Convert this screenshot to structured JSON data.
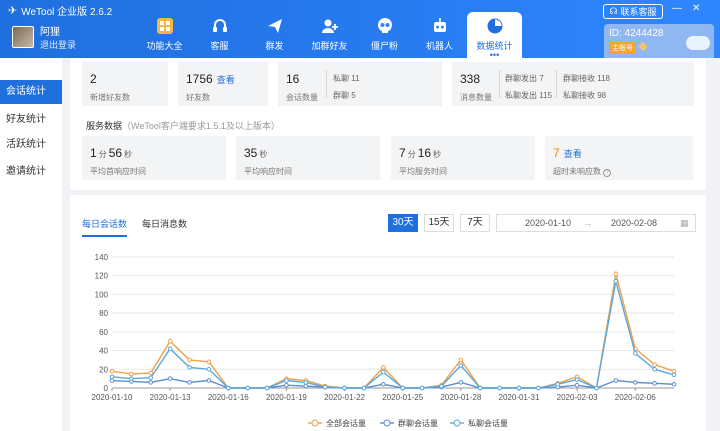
{
  "app": {
    "title": "WeTool 企业版 2.6.2",
    "service_label": "联系客服",
    "id_text": "ID: 4244428",
    "account_badge": "主账号"
  },
  "user": {
    "name": "阿狸",
    "logout": "退出登录"
  },
  "nav": [
    {
      "label": "功能大全",
      "icon": "grid-icon"
    },
    {
      "label": "客服",
      "icon": "headset-icon"
    },
    {
      "label": "群发",
      "icon": "paper-plane-icon"
    },
    {
      "label": "加群好友",
      "icon": "add-friend-icon"
    },
    {
      "label": "僵尸粉",
      "icon": "skull-icon"
    },
    {
      "label": "机器人",
      "icon": "robot-icon"
    },
    {
      "label": "数据统计",
      "icon": "pie-chart-icon"
    }
  ],
  "sidebar": [
    {
      "label": "会话统计"
    },
    {
      "label": "好友统计"
    },
    {
      "label": "活跃统计"
    },
    {
      "label": "邀请统计"
    }
  ],
  "stats": {
    "new_friends": {
      "value": "2",
      "label": "新增好友数"
    },
    "friends": {
      "value": "1756",
      "link": "查看",
      "label": "好友数"
    },
    "sessions": {
      "value": "16",
      "label": "会话数量",
      "private": "私聊 11",
      "group": "群聊 5"
    },
    "messages": {
      "value": "338",
      "label": "消息数量",
      "g_out": "群聊发出 7",
      "g_in": "群聊接收 118",
      "p_out": "私聊发出 115",
      "p_in": "私聊接收 98"
    }
  },
  "service": {
    "title": "服务数据",
    "note": "（WeTool客户端要求1.5.1及以上版本）",
    "first_response": {
      "min": "1",
      "min_unit": "分",
      "sec": "56",
      "sec_unit": "秒",
      "label": "平均首响应时间"
    },
    "avg_response": {
      "sec": "35",
      "sec_unit": "秒",
      "label": "平均响应时间"
    },
    "avg_service": {
      "min": "7",
      "min_unit": "分",
      "sec": "16",
      "sec_unit": "秒",
      "label": "平均服务时间"
    },
    "timeout": {
      "value": "7",
      "link": "查看",
      "label": "超时未响应数"
    }
  },
  "chart_tabs": {
    "daily_sessions": "每日会话数",
    "daily_messages": "每日消息数"
  },
  "ranges": [
    "30天",
    "15天",
    "7天"
  ],
  "date_range": {
    "start": "2020-01-10",
    "sep": "→",
    "end": "2020-02-08"
  },
  "colors": {
    "accent": "#1f6fde",
    "all": "#f0a04b",
    "group": "#5b8fd6",
    "private": "#58a9e0"
  },
  "chart_data": {
    "type": "line",
    "x": [
      "2020-01-10",
      "2020-01-11",
      "2020-01-12",
      "2020-01-13",
      "2020-01-14",
      "2020-01-15",
      "2020-01-16",
      "2020-01-17",
      "2020-01-18",
      "2020-01-19",
      "2020-01-20",
      "2020-01-21",
      "2020-01-22",
      "2020-01-23",
      "2020-01-24",
      "2020-01-25",
      "2020-01-26",
      "2020-01-27",
      "2020-01-28",
      "2020-01-29",
      "2020-01-30",
      "2020-01-31",
      "2020-02-01",
      "2020-02-02",
      "2020-02-03",
      "2020-02-04",
      "2020-02-05",
      "2020-02-06",
      "2020-02-07",
      "2020-02-08"
    ],
    "xticks": [
      "2020-01-10",
      "2020-01-13",
      "2020-01-16",
      "2020-01-19",
      "2020-01-22",
      "2020-01-25",
      "2020-01-28",
      "2020-01-31",
      "2020-02-03",
      "2020-02-06"
    ],
    "ylim": [
      0,
      140
    ],
    "yticks": [
      0,
      20,
      40,
      60,
      80,
      100,
      120,
      140
    ],
    "series": [
      {
        "name": "全部会话量",
        "values": [
          18,
          15,
          16,
          50,
          30,
          28,
          0,
          0,
          0,
          10,
          8,
          2,
          0,
          0,
          22,
          0,
          0,
          3,
          30,
          0,
          0,
          0,
          0,
          5,
          12,
          0,
          122,
          42,
          25,
          18
        ]
      },
      {
        "name": "群聊会话量",
        "values": [
          8,
          7,
          6,
          10,
          6,
          8,
          0,
          0,
          0,
          3,
          2,
          1,
          0,
          0,
          4,
          0,
          0,
          1,
          6,
          0,
          0,
          0,
          0,
          1,
          3,
          0,
          8,
          6,
          5,
          4
        ]
      },
      {
        "name": "私聊会话量",
        "values": [
          12,
          10,
          11,
          42,
          22,
          20,
          0,
          0,
          0,
          8,
          6,
          1,
          0,
          0,
          17,
          0,
          0,
          2,
          24,
          0,
          0,
          0,
          0,
          4,
          9,
          0,
          114,
          37,
          20,
          14
        ]
      }
    ]
  }
}
